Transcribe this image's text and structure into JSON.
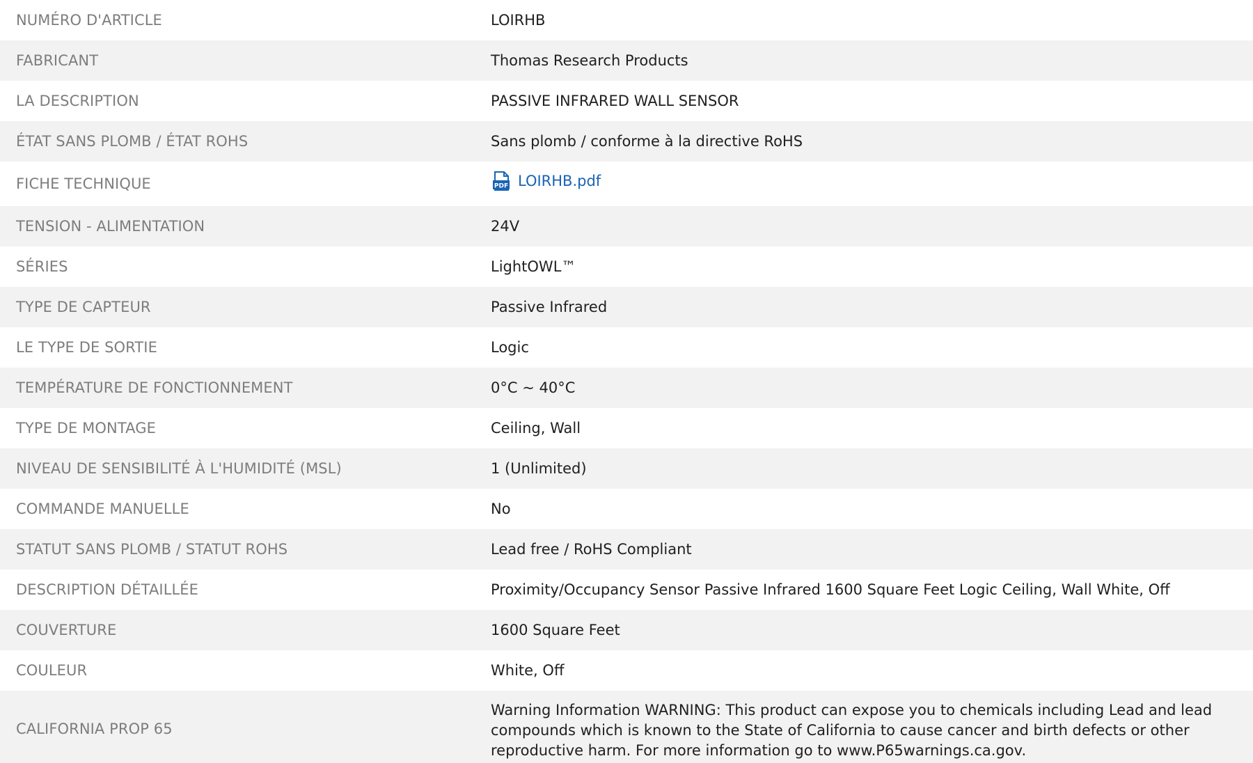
{
  "specs": [
    {
      "label": "NUMÉRO D'ARTICLE",
      "value": "LOIRHB"
    },
    {
      "label": "FABRICANT",
      "value": "Thomas Research Products"
    },
    {
      "label": "LA DESCRIPTION",
      "value": "PASSIVE INFRARED WALL SENSOR"
    },
    {
      "label": "ÉTAT SANS PLOMB / ÉTAT ROHS",
      "value": "Sans plomb / conforme à la directive RoHS"
    },
    {
      "label": "FICHE TECHNIQUE",
      "value": "LOIRHB.pdf",
      "icon": "pdf-icon",
      "icon_color": "#1a63b5"
    },
    {
      "label": "TENSION - ALIMENTATION",
      "value": "24V"
    },
    {
      "label": "SÉRIES",
      "value": "LightOWL™"
    },
    {
      "label": "TYPE DE CAPTEUR",
      "value": "Passive Infrared"
    },
    {
      "label": "LE TYPE DE SORTIE",
      "value": "Logic"
    },
    {
      "label": "TEMPÉRATURE DE FONCTIONNEMENT",
      "value": "0°C ~ 40°C"
    },
    {
      "label": "TYPE DE MONTAGE",
      "value": "Ceiling, Wall"
    },
    {
      "label": "NIVEAU DE SENSIBILITÉ À L'HUMIDITÉ (MSL)",
      "value": "1 (Unlimited)"
    },
    {
      "label": "COMMANDE MANUELLE",
      "value": "No"
    },
    {
      "label": "STATUT SANS PLOMB / STATUT ROHS",
      "value": "Lead free / RoHS Compliant"
    },
    {
      "label": "DESCRIPTION DÉTAILLÉE",
      "value": "Proximity/Occupancy Sensor Passive Infrared 1600 Square Feet Logic Ceiling, Wall White, Off"
    },
    {
      "label": "COUVERTURE",
      "value": "1600 Square Feet"
    },
    {
      "label": "COULEUR",
      "value": "White, Off"
    },
    {
      "label": "CALIFORNIA PROP 65",
      "value": "Warning Information WARNING: This product can expose you to chemicals including Lead and lead compounds which is known to the State of California to cause cancer and birth defects or other reproductive harm. For more information go to www.P65warnings.ca.gov."
    }
  ],
  "colors": {
    "label_text": "#7d7d7d",
    "value_text": "#1f1f1f",
    "link": "#1a63b5",
    "stripe": "#f2f2f2"
  }
}
